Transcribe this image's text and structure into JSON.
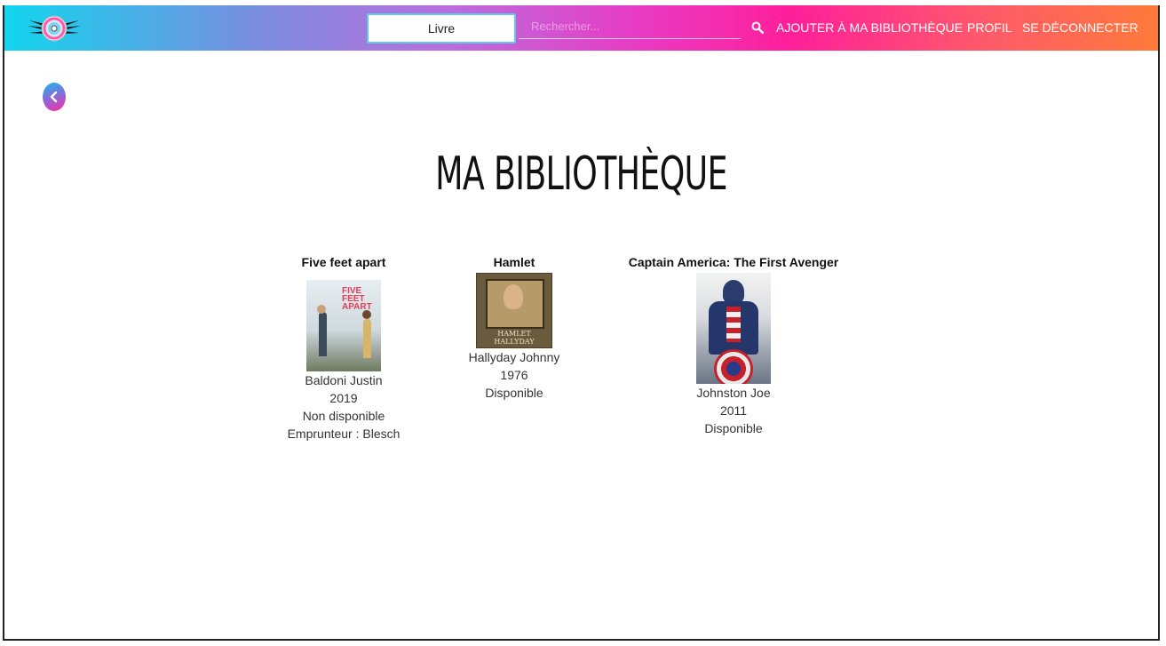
{
  "header": {
    "type_select": {
      "value": "Livre"
    },
    "search": {
      "placeholder": "Rechercher..."
    },
    "nav": {
      "add": "AJOUTER À MA BIBLIOTHÈQUE",
      "profile": "PROFIL",
      "logout": "SE DÉCONNECTER"
    },
    "icons": {
      "logo": "winged-disc-logo-icon",
      "search": "search-icon"
    }
  },
  "back_button": {
    "icon": "chevron-left-icon"
  },
  "page": {
    "title": "MA BIBLIOTHÈQUE"
  },
  "books": [
    {
      "title": "Five feet apart",
      "cover_text": [
        "FIVE",
        "FEET",
        "APART"
      ],
      "author": "Baldoni Justin",
      "year": "2019",
      "status": "Non disponible",
      "borrower": "Emprunteur : Blesch"
    },
    {
      "title": "Hamlet",
      "cover_text": [
        "HAMLET",
        "HALLYDAY"
      ],
      "author": "Hallyday Johnny",
      "year": "1976",
      "status": "Disponible"
    },
    {
      "title": "Captain America: The First Avenger",
      "author": "Johnston Joe",
      "year": "2011",
      "status": "Disponible"
    }
  ],
  "colors": {
    "gradient_start": "#12d6ee",
    "gradient_mid": "#ff1f9a",
    "gradient_end": "#ff7a3a"
  }
}
